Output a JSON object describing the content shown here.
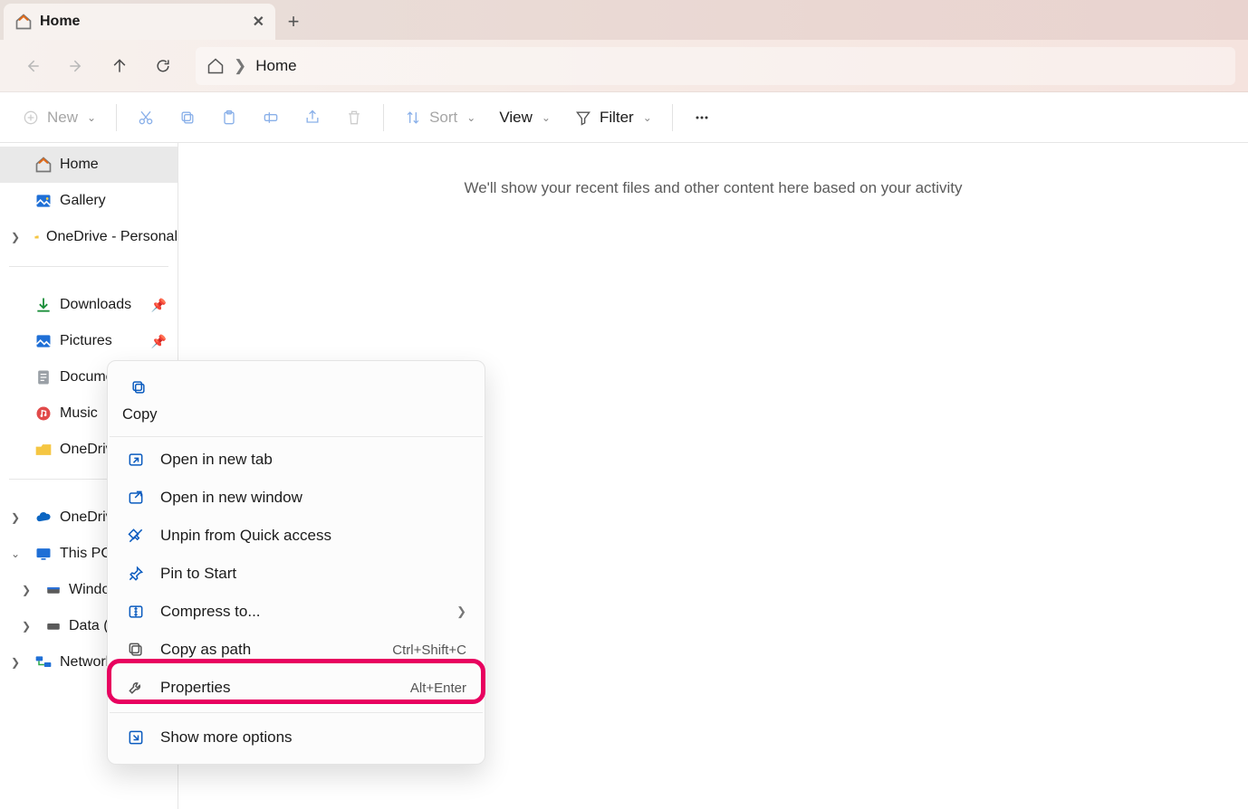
{
  "tab": {
    "title": "Home"
  },
  "breadcrumb": {
    "location": "Home"
  },
  "toolbar": {
    "new_label": "New",
    "sort_label": "Sort",
    "view_label": "View",
    "filter_label": "Filter"
  },
  "sidebar": {
    "items": [
      {
        "label": "Home"
      },
      {
        "label": "Gallery"
      },
      {
        "label": "OneDrive - Personal"
      },
      {
        "label": "Downloads"
      },
      {
        "label": "Pictures"
      },
      {
        "label": "Documents"
      },
      {
        "label": "Music"
      },
      {
        "label": "OneDrive"
      },
      {
        "label": "OneDrive"
      },
      {
        "label": "This PC"
      },
      {
        "label": "Windows"
      },
      {
        "label": "Data (D:)"
      },
      {
        "label": "Network"
      }
    ]
  },
  "content": {
    "empty_message": "We'll show your recent files and other content here based on your activity"
  },
  "contextmenu": {
    "copy_label": "Copy",
    "items": [
      {
        "label": "Open in new tab"
      },
      {
        "label": "Open in new window"
      },
      {
        "label": "Unpin from Quick access"
      },
      {
        "label": "Pin to Start"
      },
      {
        "label": "Compress to..."
      },
      {
        "label": "Copy as path",
        "shortcut": "Ctrl+Shift+C"
      },
      {
        "label": "Properties",
        "shortcut": "Alt+Enter"
      },
      {
        "label": "Show more options"
      }
    ]
  }
}
